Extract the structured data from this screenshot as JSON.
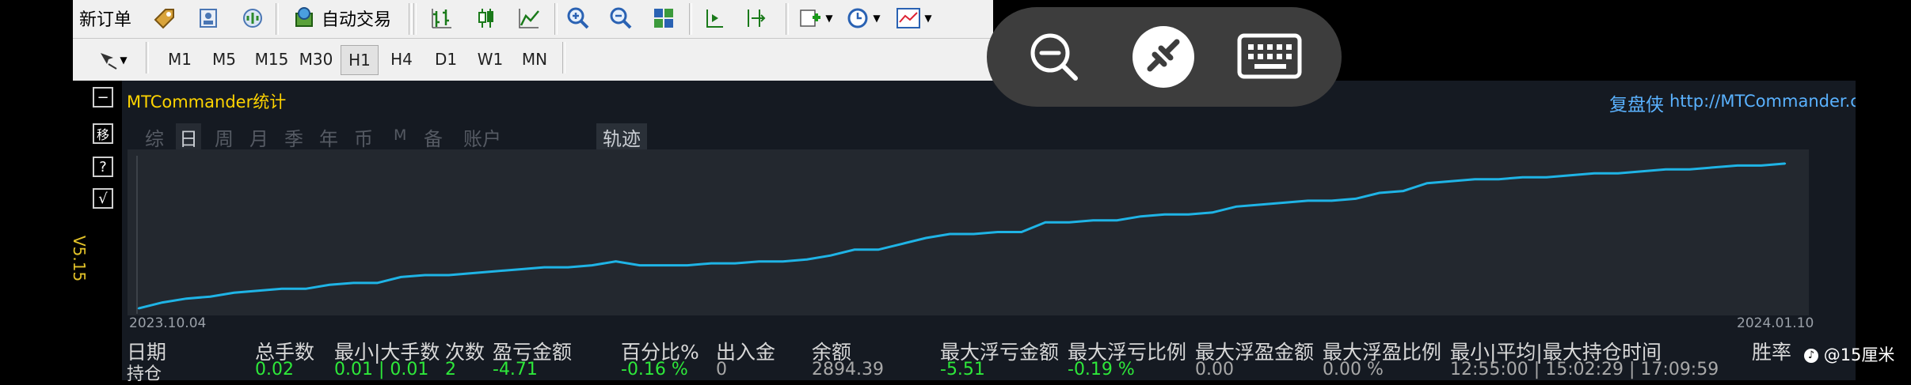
{
  "toolbar": {
    "new_order": "新订单",
    "auto_trade": "自动交易"
  },
  "timeframes": [
    "M1",
    "M5",
    "M15",
    "M30",
    "H1",
    "H4",
    "D1",
    "W1",
    "MN"
  ],
  "active_timeframe": "H1",
  "side_buttons": [
    "−",
    "移",
    "?",
    "√"
  ],
  "version": "V5.15",
  "panel": {
    "title": "MTCommander统计",
    "brand": "复盘侠",
    "url": "http://MTCommander.cor",
    "tabs": [
      "综",
      "日",
      "周",
      "月",
      "季",
      "年",
      "币",
      "M",
      "备",
      "账户"
    ],
    "active_tab": "日",
    "track_tab": "轨迹"
  },
  "chart_data": {
    "type": "line",
    "x_start": "2023.10.04",
    "x_end": "2024.01.10",
    "color": "#1fb4e6",
    "series": [
      {
        "values": [
          2,
          5,
          7,
          8,
          10,
          11,
          12,
          12,
          14,
          15,
          15,
          18,
          19,
          19,
          20,
          21,
          22,
          23,
          23,
          24,
          26,
          24,
          24,
          24,
          25,
          25,
          26,
          26,
          27,
          29,
          32,
          32,
          35,
          38,
          40,
          40,
          41,
          41,
          46,
          46,
          47,
          47,
          49,
          50,
          50,
          51,
          54,
          55,
          56,
          57,
          57,
          58,
          61,
          62,
          66,
          67,
          68,
          68,
          69,
          69,
          70,
          71,
          71,
          72,
          73,
          73,
          74,
          75,
          75,
          76
        ]
      }
    ],
    "ylim": [
      0,
      80
    ]
  },
  "table": {
    "headers": [
      "日期",
      "总手数",
      "最小|大手数",
      "次数",
      "盈亏金额",
      "百分比%",
      "出入金",
      "余额",
      "最大浮亏金额",
      "最大浮亏比例",
      "最大浮盈金额",
      "最大浮盈比例",
      "最小|平均|最大持仓时间",
      "胜率"
    ],
    "row_label": "持仓",
    "values": [
      "0.02",
      "0.01 | 0.01",
      "2",
      "-4.71",
      "-0.16 %",
      "0",
      "2894.39",
      "-5.51",
      "-0.19 %",
      "0.00",
      "0.00 %",
      "12:55:00 | 15:02:29 | 17:09:59"
    ]
  },
  "colors": {
    "positive": "#2ee83a",
    "negative": "#2ee83a",
    "neutral": "#a8a8a8"
  },
  "watermark": "@15厘米"
}
